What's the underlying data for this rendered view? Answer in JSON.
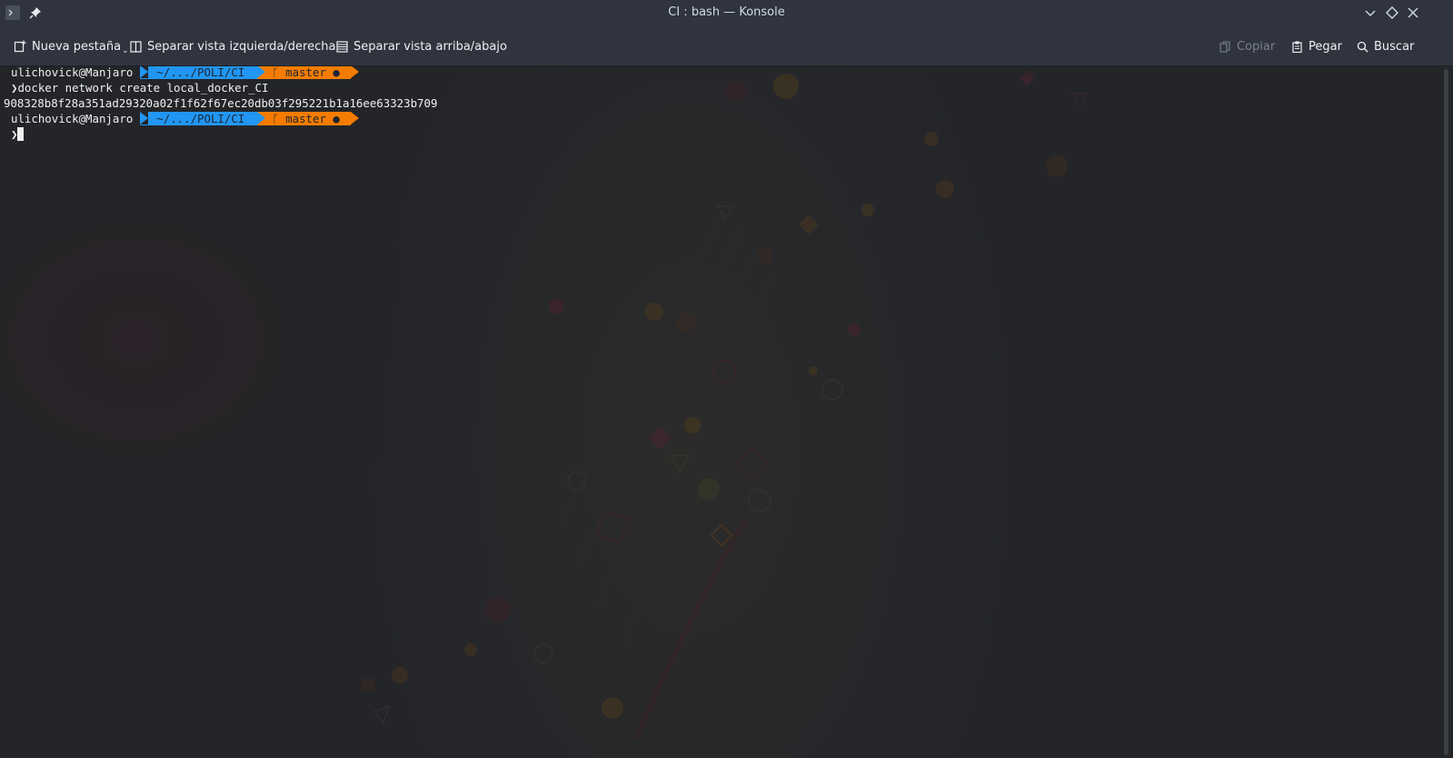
{
  "window": {
    "title": "CI : bash — Konsole",
    "icons": {
      "app": "konsole-icon",
      "pin": "pin-icon",
      "minimize": "chevron-down-icon",
      "maximize": "diamond-icon",
      "close": "close-icon"
    }
  },
  "toolbar": {
    "new_tab": "Nueva pestaña",
    "split_lr": "Separar vista izquierda/derecha",
    "split_tb": "Separar vista arriba/abajo",
    "copy": "Copiar",
    "paste": "Pegar",
    "find": "Buscar"
  },
  "terminal": {
    "prompt1": {
      "user": "ulichovick@Manjaro",
      "path": "~/.../POLI/CI",
      "git": "ᚴ master ●"
    },
    "command": "❯docker network create local_docker_CI",
    "output": "908328b8f28a351ad29320a02f1f62f67ec20db03f295221b1a16ee63323b709",
    "prompt2": {
      "user": "ulichovick@Manjaro",
      "path": "~/.../POLI/CI",
      "git": "ᚴ master ●"
    },
    "input_prompt": "❯"
  },
  "colors": {
    "path_segment": "#2196f3",
    "git_segment": "#f57c00",
    "background": "#232529",
    "chrome": "#2f343f"
  }
}
